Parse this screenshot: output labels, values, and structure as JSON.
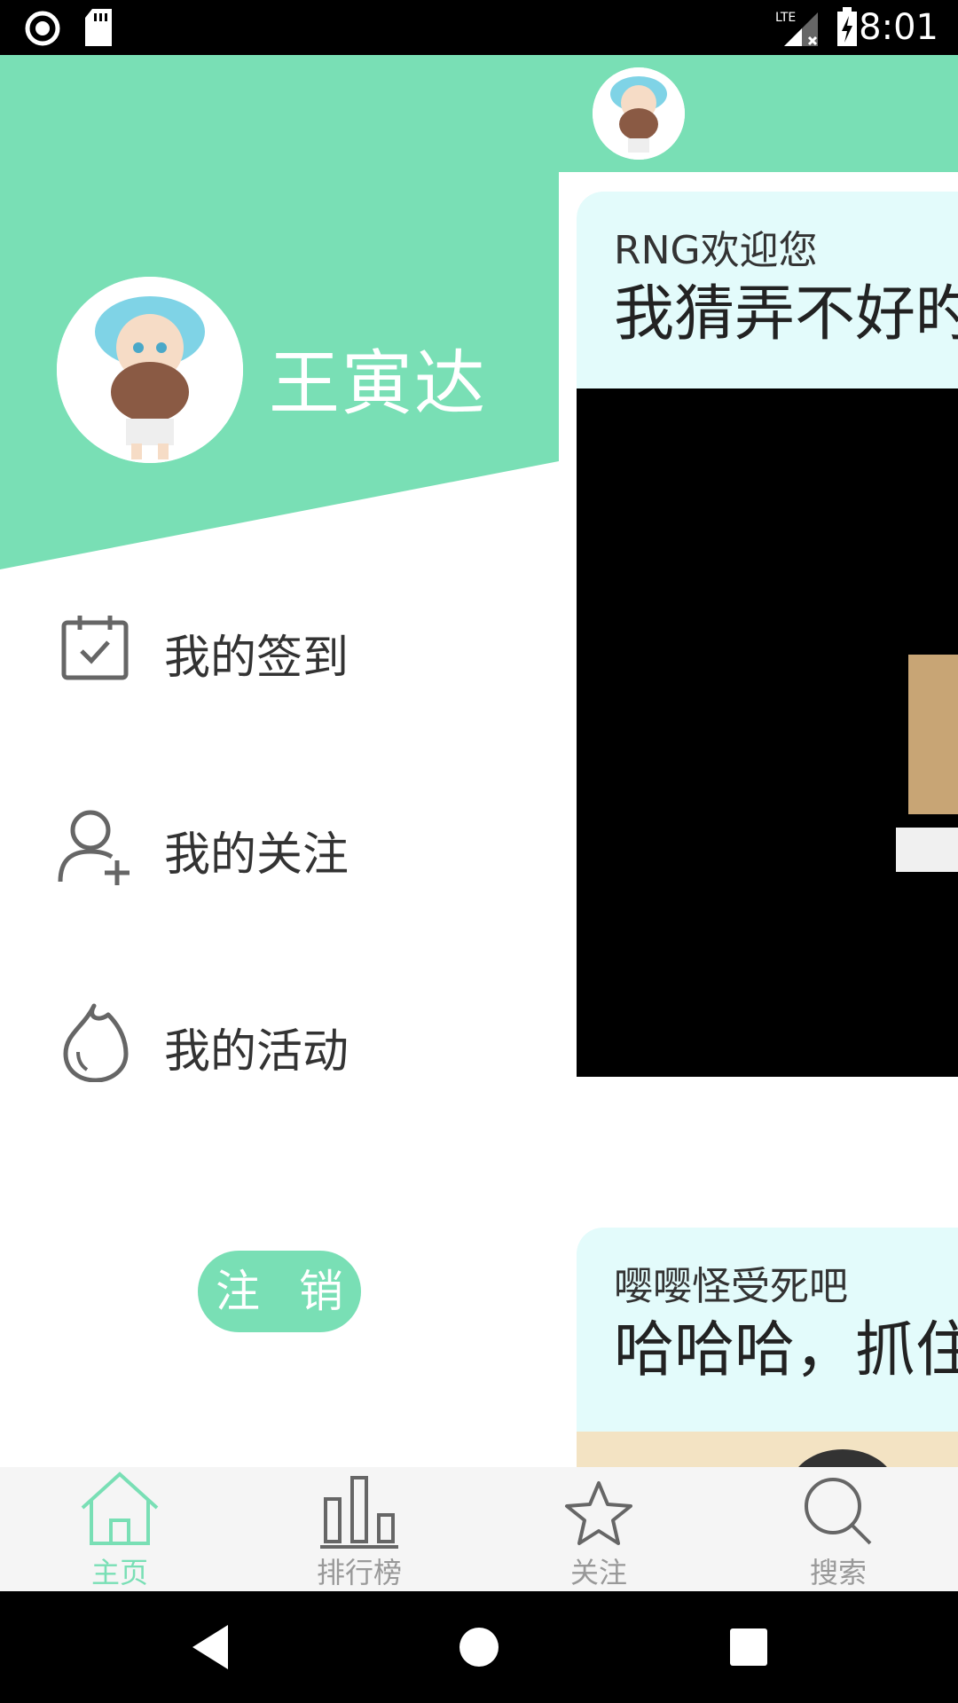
{
  "status_bar": {
    "time": "8:01",
    "network": "LTE"
  },
  "drawer": {
    "username": "王寅达",
    "menu": [
      {
        "label": "我的签到",
        "icon": "calendar-check-icon"
      },
      {
        "label": "我的关注",
        "icon": "add-user-icon"
      },
      {
        "label": "我的活动",
        "icon": "flame-icon"
      }
    ],
    "logout_label": "注 销"
  },
  "feed": {
    "cards": [
      {
        "author": "RNG欢迎您",
        "title": "我猜弄不好旳"
      },
      {
        "author": "嘤嘤怪受死吧",
        "title": "哈哈哈，抓住"
      }
    ]
  },
  "tabbar": {
    "tabs": [
      {
        "label": "主页",
        "icon": "home-icon",
        "active": true
      },
      {
        "label": "排行榜",
        "icon": "bar-chart-icon",
        "active": false
      },
      {
        "label": "关注",
        "icon": "star-icon",
        "active": false
      },
      {
        "label": "搜索",
        "icon": "search-icon",
        "active": false
      }
    ]
  },
  "colors": {
    "accent": "#79dfb5",
    "card_bg": "#e3fbfb"
  }
}
